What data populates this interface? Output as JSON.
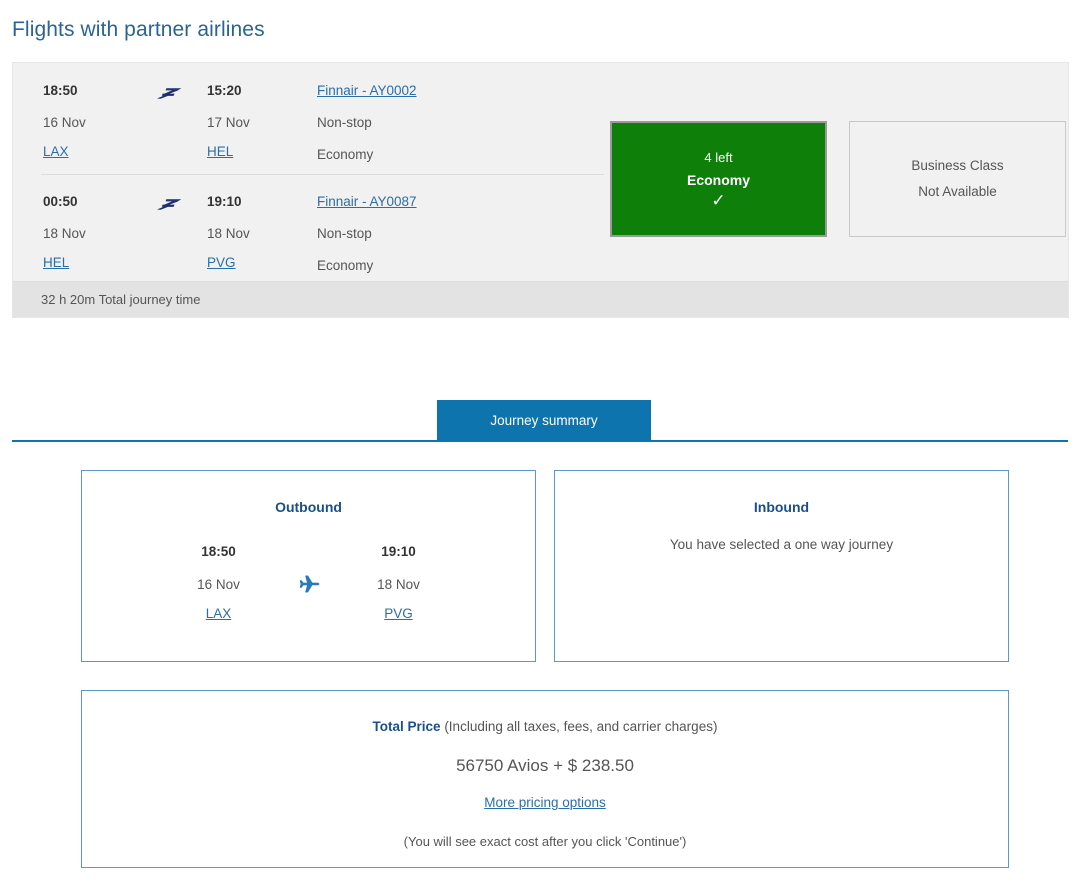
{
  "header": {
    "title": "Flights with partner airlines"
  },
  "flight_card": {
    "segments": [
      {
        "depart_time": "18:50",
        "depart_date": "16 Nov",
        "depart_airport": "LAX",
        "arrive_time": "15:20",
        "arrive_date": "17 Nov",
        "arrive_airport": "HEL",
        "flight_link": "Finnair - AY0002",
        "stops": "Non-stop",
        "cabin": "Economy",
        "airline_logo_icon": "finnair-logo-icon"
      },
      {
        "depart_time": "00:50",
        "depart_date": "18 Nov",
        "depart_airport": "HEL",
        "arrive_time": "19:10",
        "arrive_date": "18 Nov",
        "arrive_airport": "PVG",
        "flight_link": "Finnair - AY0087",
        "stops": "Non-stop",
        "cabin": "Economy",
        "airline_logo_icon": "finnair-logo-icon"
      }
    ],
    "fares": [
      {
        "seats_left": "4 left",
        "cabin": "Economy",
        "selected_icon": "check-icon",
        "state": "selected",
        "color": "#0e8009"
      },
      {
        "line1": "Business Class",
        "line2": "Not Available",
        "state": "unavailable"
      }
    ],
    "journey_time": "32 h 20m Total journey time"
  },
  "tabs": {
    "journey_summary_label": "Journey summary"
  },
  "summary": {
    "outbound": {
      "title": "Outbound",
      "depart_time": "18:50",
      "depart_date": "16 Nov",
      "depart_airport": "LAX",
      "arrive_time": "19:10",
      "arrive_date": "18 Nov",
      "arrive_airport": "PVG",
      "plane_icon": "airplane-icon"
    },
    "inbound": {
      "title": "Inbound",
      "note": "You have selected a one way journey"
    }
  },
  "price": {
    "label_bold": "Total Price",
    "label_rest": " (Including all taxes, fees, and carrier charges)",
    "amount": "56750 Avios + $ 238.50",
    "more_options_link": "More pricing options",
    "note": "(You will see exact cost after you click 'Continue')"
  },
  "colors": {
    "accent_blue": "#0e74ad",
    "link_blue": "#2a6ea8",
    "title_blue": "#2a6496",
    "selected_green": "#0e8009",
    "panel_border": "#5a9bc4"
  }
}
